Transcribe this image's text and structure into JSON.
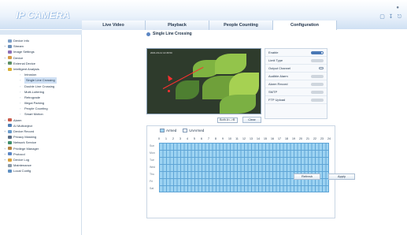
{
  "app": {
    "logo": "IP CAMERA"
  },
  "tabs": [
    {
      "label": "Live Video",
      "active": false
    },
    {
      "label": "Playback",
      "active": false
    },
    {
      "label": "People Counting",
      "active": false
    },
    {
      "label": "Configuration",
      "active": true
    }
  ],
  "sidebar": {
    "items": [
      {
        "label": "Device Info",
        "level": 0,
        "expander": "",
        "icon": "device-info-icon",
        "color": "#7ea0c9"
      },
      {
        "label": "Stream",
        "level": 0,
        "expander": "+",
        "icon": "stream-icon",
        "color": "#6b8fb9"
      },
      {
        "label": "Image Settings",
        "level": 0,
        "expander": "",
        "icon": "image-settings-icon",
        "color": "#8d6fb6"
      },
      {
        "label": "Device",
        "level": 0,
        "expander": "+",
        "icon": "device-icon",
        "color": "#d59a45"
      },
      {
        "label": "External Device",
        "level": 0,
        "expander": "+",
        "icon": "external-device-icon",
        "color": "#5c8f63"
      },
      {
        "label": "Intelligent Analysis",
        "level": 0,
        "expander": "-",
        "icon": "intelligent-analysis-icon",
        "color": "#d9b036"
      },
      {
        "label": "Intrusion",
        "level": 1
      },
      {
        "label": "Single Line Crossing",
        "level": 1,
        "selected": true
      },
      {
        "label": "Double Line Crossing",
        "level": 1
      },
      {
        "label": "Multi-Loitering",
        "level": 1
      },
      {
        "label": "Retrograde",
        "level": 1
      },
      {
        "label": "Illegal Parking",
        "level": 1
      },
      {
        "label": "People Counting",
        "level": 1
      },
      {
        "label": "Smart Motion",
        "level": 1
      },
      {
        "label": "Alarm",
        "level": 0,
        "expander": "+",
        "icon": "alarm-icon",
        "color": "#c95b4b"
      },
      {
        "label": "AI Multiobject",
        "level": 0,
        "expander": "",
        "icon": "ai-multiobject-icon",
        "color": "#4f7fb6"
      },
      {
        "label": "Device Record",
        "level": 0,
        "expander": "+",
        "icon": "device-record-icon",
        "color": "#6a9ccd"
      },
      {
        "label": "Privacy Masking",
        "level": 0,
        "expander": "",
        "icon": "privacy-masking-icon",
        "color": "#5d6f86"
      },
      {
        "label": "Network Service",
        "level": 0,
        "expander": "+",
        "icon": "network-service-icon",
        "color": "#3f8f6b"
      },
      {
        "label": "Privilege Manager",
        "level": 0,
        "expander": "+",
        "icon": "privilege-manager-icon",
        "color": "#b5833f"
      },
      {
        "label": "Protocol",
        "level": 0,
        "expander": "+",
        "icon": "protocol-icon",
        "color": "#5b86c3"
      },
      {
        "label": "Device Log",
        "level": 0,
        "expander": "+",
        "icon": "device-log-icon",
        "color": "#d9a23e"
      },
      {
        "label": "Maintenance",
        "level": 0,
        "expander": "",
        "icon": "maintenance-icon",
        "color": "#8a9aa9"
      },
      {
        "label": "Local Config",
        "level": 0,
        "expander": "",
        "icon": "local-config-icon",
        "color": "#5f8fc2"
      }
    ]
  },
  "main": {
    "title": "Single Line Crossing",
    "video": {
      "timestamp": "2021-03-11 14:36:50"
    },
    "direction": {
      "selected": "Both A<->B"
    },
    "clear_label": "Clear",
    "settings": [
      {
        "label": "Enable",
        "control": "toggle",
        "on": true
      },
      {
        "label": "Limit Type",
        "control": "toggle",
        "on": false
      },
      {
        "label": "Output Channel",
        "control": "link",
        "on": false
      },
      {
        "label": "Audible Alarm",
        "control": "toggle",
        "on": false
      },
      {
        "label": "Alarm Record",
        "control": "toggle",
        "on": false
      },
      {
        "label": "SMTP",
        "control": "toggle",
        "on": false
      },
      {
        "label": "FTP Upload",
        "control": "toggle",
        "on": false
      }
    ],
    "schedule": {
      "armed_label": "Armed",
      "unarmed_label": "UnArmed",
      "hours": [
        "0",
        "1",
        "2",
        "3",
        "4",
        "5",
        "6",
        "7",
        "8",
        "9",
        "10",
        "11",
        "12",
        "13",
        "14",
        "15",
        "16",
        "17",
        "18",
        "19",
        "20",
        "21",
        "22",
        "23",
        "24"
      ],
      "days": [
        "Sun",
        "Mon",
        "Tue",
        "Wed",
        "Thu",
        "Fri",
        "Sat"
      ]
    },
    "refresh_label": "Refresh",
    "apply_label": "Apply"
  },
  "colors": {
    "accent": "#4a78b5",
    "grid_fill": "#9dd3f2",
    "grid_line": "#5fa5d6"
  }
}
